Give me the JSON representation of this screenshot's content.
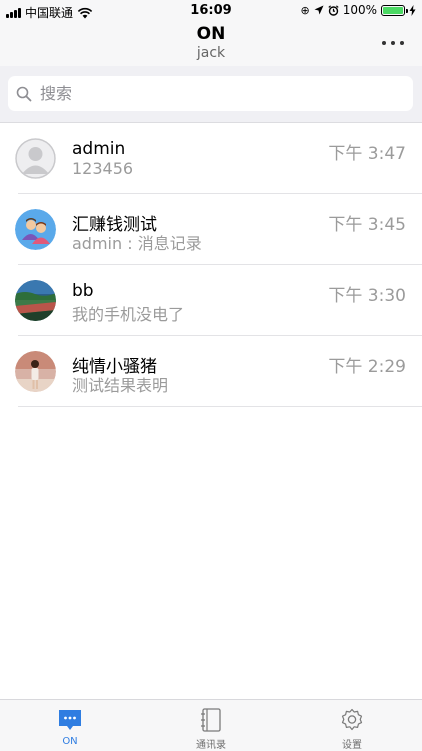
{
  "status_bar": {
    "carrier": "中国联通",
    "time": "16:09",
    "battery_text": "100%"
  },
  "nav": {
    "title": "ON",
    "subtitle": "jack",
    "more_icon": "more-dots-icon"
  },
  "search": {
    "placeholder": "搜索"
  },
  "conversations": [
    {
      "name": "admin",
      "message": "123456",
      "time": "下午 3:47",
      "avatar": "default-avatar"
    },
    {
      "name": "汇赚钱测试",
      "message": "admin : 消息记录",
      "time": "下午 3:45",
      "avatar": "group-avatar"
    },
    {
      "name": "bb",
      "message": "我的手机没电了",
      "time": "下午 3:30",
      "avatar": "landscape-photo-avatar"
    },
    {
      "name": "纯情小骚猪",
      "message": "测试结果表明",
      "time": "下午 2:29",
      "avatar": "person-photo-avatar"
    }
  ],
  "tabs": [
    {
      "label": "ON",
      "icon": "chat-bubble-icon",
      "active": true
    },
    {
      "label": "通讯录",
      "icon": "contacts-book-icon",
      "active": false
    },
    {
      "label": "设置",
      "icon": "settings-gear-icon",
      "active": false
    }
  ],
  "colors": {
    "accent": "#2f7de1",
    "secondary_text": "#9b9b9b",
    "bar_background": "#f7f7f8",
    "search_background": "#f0f0f4"
  }
}
